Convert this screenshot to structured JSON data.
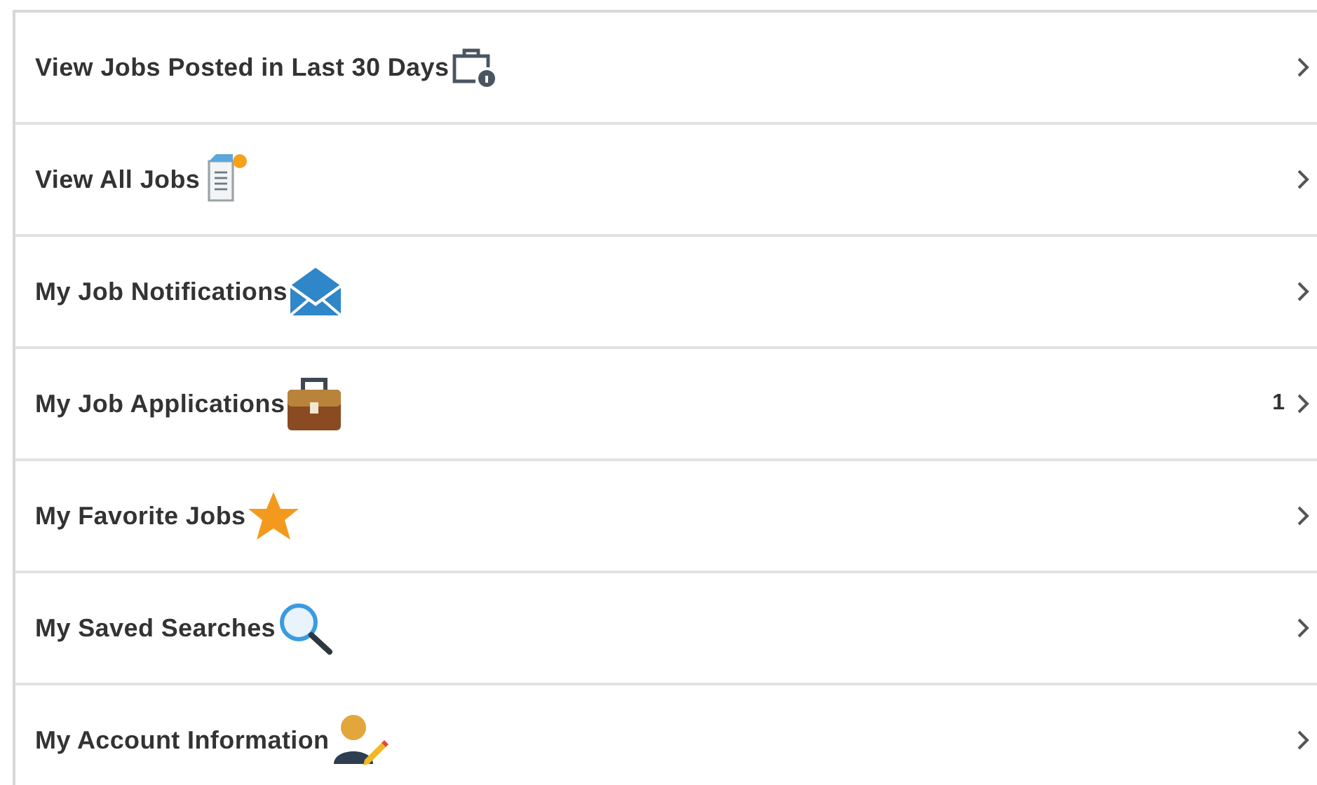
{
  "menu": {
    "items": [
      {
        "label": "View Jobs Posted in Last 30 Days"
      },
      {
        "label": "View All Jobs"
      },
      {
        "label": "My Job Notifications"
      },
      {
        "label": "My Job Applications",
        "count": "1"
      },
      {
        "label": "My Favorite Jobs"
      },
      {
        "label": "My Saved Searches"
      },
      {
        "label": "My Account Information"
      }
    ]
  }
}
